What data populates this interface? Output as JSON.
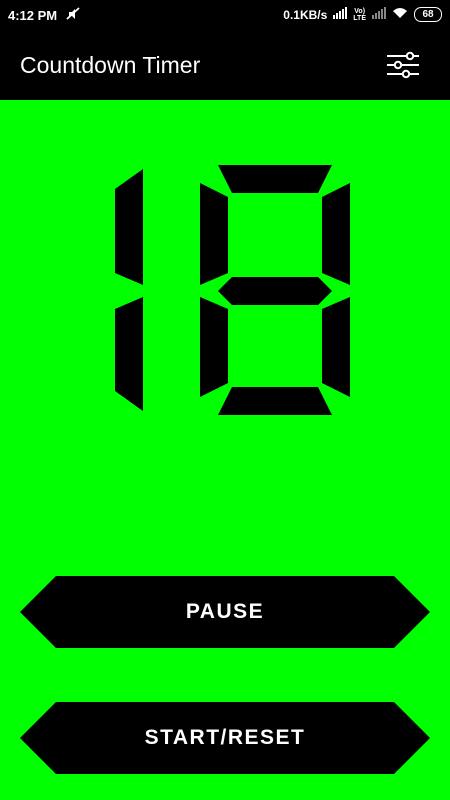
{
  "status": {
    "time": "4:12 PM",
    "network_speed": "0.1KB/s",
    "lte_top": "Vo)",
    "lte_bottom": "LTE",
    "battery": "68"
  },
  "app": {
    "title": "Countdown Timer"
  },
  "timer": {
    "value": "18"
  },
  "buttons": {
    "pause": "PAUSE",
    "start_reset": "START/RESET"
  },
  "colors": {
    "background": "#00ff00",
    "bars": "#000000",
    "segment": "#000000",
    "button_text": "#ffffff"
  }
}
